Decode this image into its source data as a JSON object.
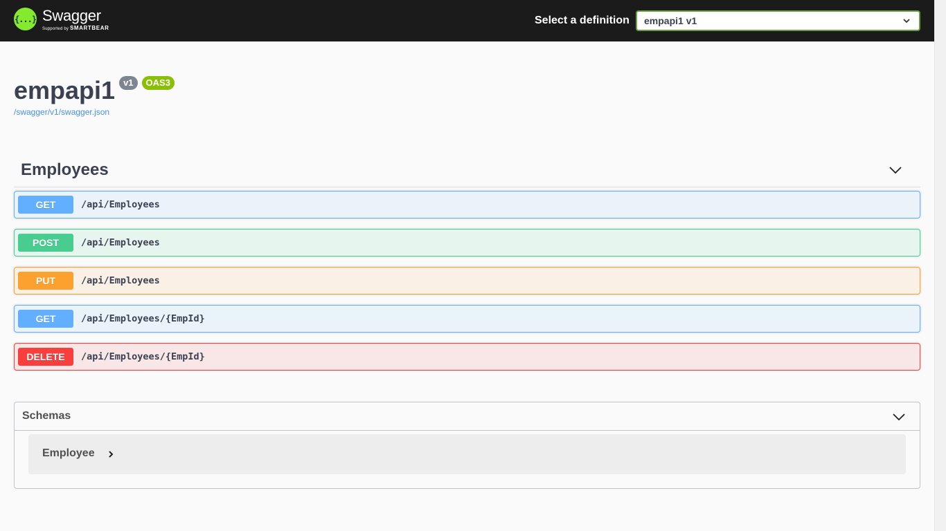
{
  "topbar": {
    "logo_icon": "{...}",
    "logo_name": "Swagger",
    "logo_sub_prefix": "Supported by",
    "logo_sub_brand": "SMARTBEAR",
    "definition_label": "Select a definition",
    "definition_value": "empapi1 v1"
  },
  "info": {
    "title": "empapi1",
    "version": "v1",
    "oas": "OAS3",
    "spec_url": "/swagger/v1/swagger.json"
  },
  "tag": {
    "name": "Employees"
  },
  "operations": [
    {
      "method": "GET",
      "path": "/api/Employees"
    },
    {
      "method": "POST",
      "path": "/api/Employees"
    },
    {
      "method": "PUT",
      "path": "/api/Employees"
    },
    {
      "method": "GET",
      "path": "/api/Employees/{EmpId}"
    },
    {
      "method": "DELETE",
      "path": "/api/Employees/{EmpId}"
    }
  ],
  "schemas": {
    "title": "Schemas",
    "models": [
      "Employee"
    ]
  },
  "colors": {
    "get": "#61affe",
    "post": "#49cc90",
    "put": "#fca130",
    "delete": "#f93e3e",
    "topbar": "#1b1b1b",
    "logo": "#85ea2d"
  },
  "icons": {
    "tag_toggle": "chevron-down-icon",
    "schemas_toggle": "chevron-down-icon",
    "model_expand": "chevron-right-icon",
    "select_arrow": "chevron-down-icon"
  }
}
